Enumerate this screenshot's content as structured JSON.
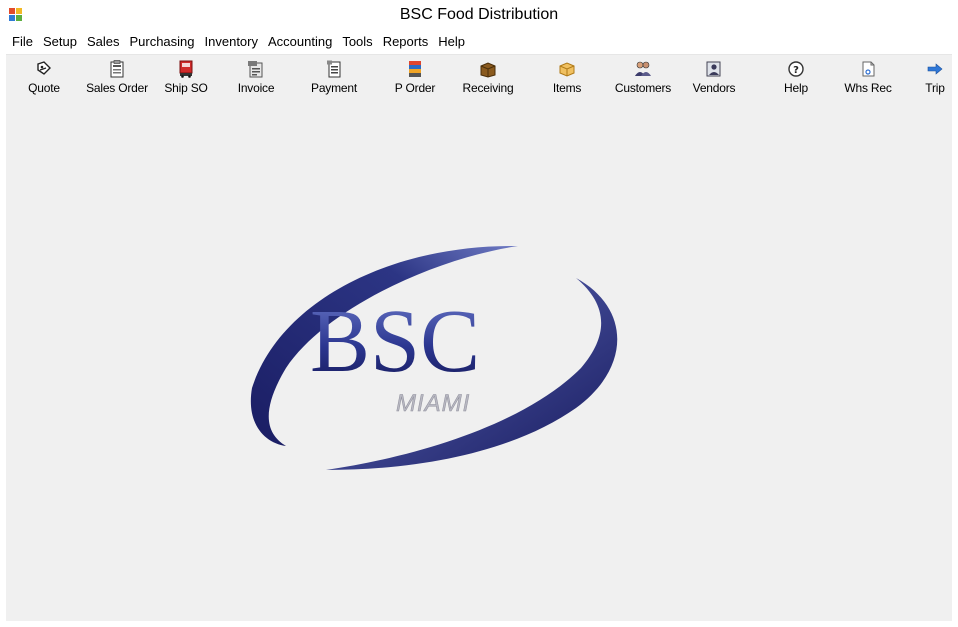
{
  "window": {
    "title": "BSC Food Distribution"
  },
  "menu": [
    "File",
    "Setup",
    "Sales",
    "Purchasing",
    "Inventory",
    "Accounting",
    "Tools",
    "Reports",
    "Help"
  ],
  "toolbar": {
    "quote": "Quote",
    "sales_order": "Sales Order",
    "ship_so": "Ship SO",
    "invoice": "Invoice",
    "payment": "Payment",
    "p_order": "P Order",
    "receiving": "Receiving",
    "items": "Items",
    "customers": "Customers",
    "vendors": "Vendors",
    "help": "Help",
    "whs_rec": "Whs Rec",
    "trip": "Trip"
  },
  "logo": {
    "main_text": "BSC",
    "sub_text": "MIAMI"
  },
  "colors": {
    "logo_navy": "#1c1f66",
    "logo_blue": "#3a4aa3",
    "logo_silver": "#b5b5bd"
  }
}
